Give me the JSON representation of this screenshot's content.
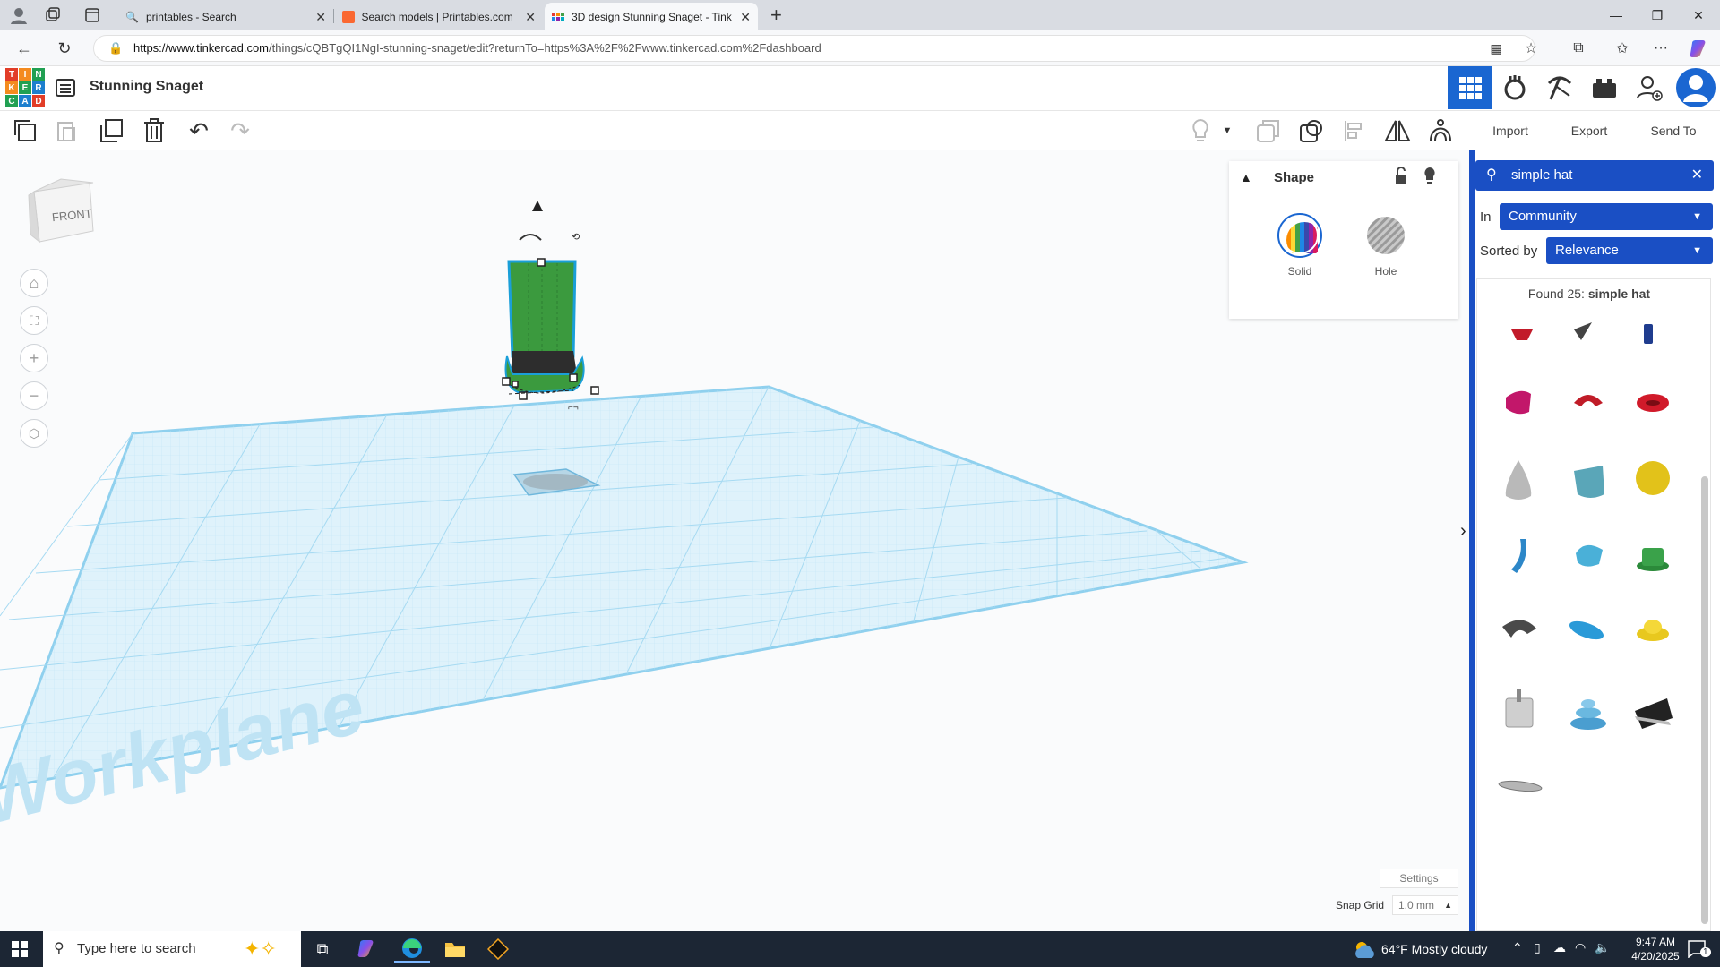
{
  "browser": {
    "tabs": [
      {
        "title": "printables - Search"
      },
      {
        "title": "Search models | Printables.com"
      },
      {
        "title": "3D design Stunning Snaget - Tink"
      }
    ],
    "url": "https://www.tinkercad.com/things/cQBTgQI1NgI-stunning-snaget/edit?returnTo=https%3A%2F%2Fwww.tinkercad.com%2Fdashboard",
    "url_host": "https://www.tinkercad.com",
    "url_path": "/things/cQBTgQI1NgI-stunning-snaget/edit?returnTo=https%3A%2F%2Fwww.tinkercad.com%2Fdashboard"
  },
  "app": {
    "logo_letters": [
      "T",
      "I",
      "N",
      "K",
      "E",
      "R",
      "C",
      "A",
      "D"
    ],
    "design_title": "Stunning Snaget"
  },
  "toolbar": {
    "import_label": "Import",
    "export_label": "Export",
    "sendto_label": "Send To"
  },
  "viewport": {
    "viewcube_label": "FRONT",
    "workplane_label": "Workplane"
  },
  "shape_panel": {
    "title": "Shape",
    "solid_label": "Solid",
    "hole_label": "Hole"
  },
  "footer_controls": {
    "settings_label": "Settings",
    "snap_grid_label": "Snap Grid",
    "snap_grid_value": "1.0 mm"
  },
  "library": {
    "search_query": "simple hat",
    "in_label": "In",
    "in_value": "Community",
    "sorted_label": "Sorted by",
    "sorted_value": "Relevance",
    "found_prefix": "Found 25:",
    "found_query": "simple hat"
  },
  "taskbar": {
    "search_placeholder": "Type here to search",
    "weather": "64°F  Mostly cloudy",
    "time": "9:47 AM",
    "date": "4/20/2025",
    "notification_count": "1"
  },
  "colors": {
    "tinkercad_blue": "#1a4fc4",
    "hat_green": "#3b9a3e",
    "grid_blue": "#8fd0ee"
  }
}
